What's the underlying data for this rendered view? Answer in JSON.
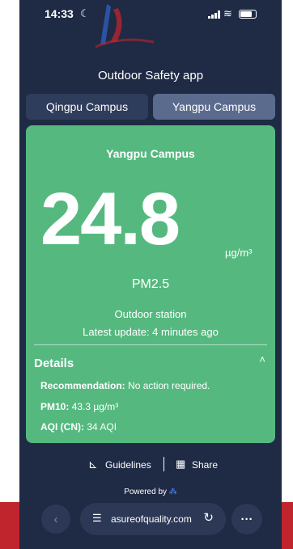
{
  "status_bar": {
    "time": "14:33"
  },
  "app": {
    "title": "Outdoor Safety app"
  },
  "tabs": [
    {
      "label": "Qingpu Campus",
      "active": false
    },
    {
      "label": "Yangpu Campus",
      "active": true
    }
  ],
  "card": {
    "campus": "Yangpu Campus",
    "value": "24.8",
    "unit": "µg/m³",
    "pollutant": "PM2.5",
    "station": "Outdoor station",
    "updated": "Latest update: 4 minutes ago",
    "color": "#55b97f"
  },
  "details": {
    "title": "Details",
    "recommendation_label": "Recommendation:",
    "recommendation_value": " No action required.",
    "pm10_label": "PM10:",
    "pm10_value": " 43.3 µg/m³",
    "aqi_label": "AQI (CN):",
    "aqi_value": " 34 AQI"
  },
  "footer": {
    "guidelines": "Guidelines",
    "share": "Share",
    "powered_by": "Powered by"
  },
  "browser": {
    "url": "asureofquality.com"
  }
}
